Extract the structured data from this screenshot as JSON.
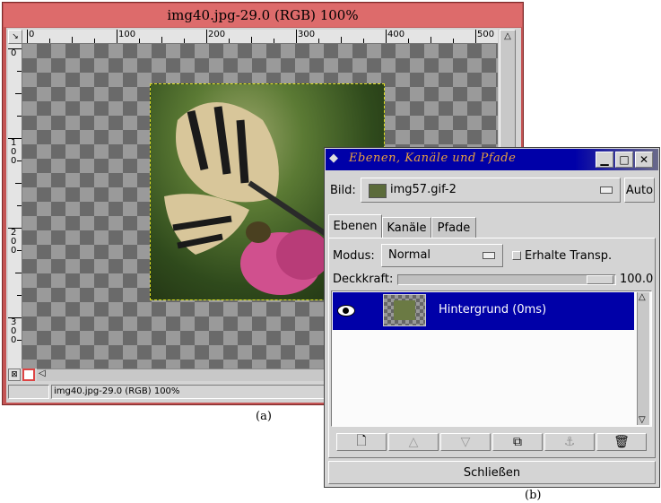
{
  "image_window": {
    "title": "img40.jpg-29.0 (RGB) 100%",
    "status_text": "img40.jpg-29.0 (RGB) 100%",
    "ruler_h": [
      "0",
      "100",
      "200",
      "300",
      "400",
      "500"
    ],
    "ruler_v": [
      "0",
      "100",
      "200",
      "300"
    ]
  },
  "layers_dialog": {
    "title": "Ebenen, Kanäle und Pfade",
    "image_label": "Bild:",
    "image_value": "img57.gif-2",
    "auto_button": "Auto",
    "tabs": [
      "Ebenen",
      "Kanäle",
      "Pfade"
    ],
    "mode_label": "Modus:",
    "mode_value": "Normal",
    "keep_trans_label": "Erhalte Transp.",
    "opacity_label": "Deckkraft:",
    "opacity_value": "100.0",
    "layers": [
      {
        "name": "Hintergrund (0ms)"
      }
    ],
    "close_button": "Schließen"
  },
  "captions": {
    "a": "(a)",
    "b": "(b)"
  },
  "colors": {
    "title_red": "#dd6b6b",
    "selection_blue": "#0000a8",
    "title_blue": "#0000a8",
    "title_text_orange": "#e8a040"
  }
}
